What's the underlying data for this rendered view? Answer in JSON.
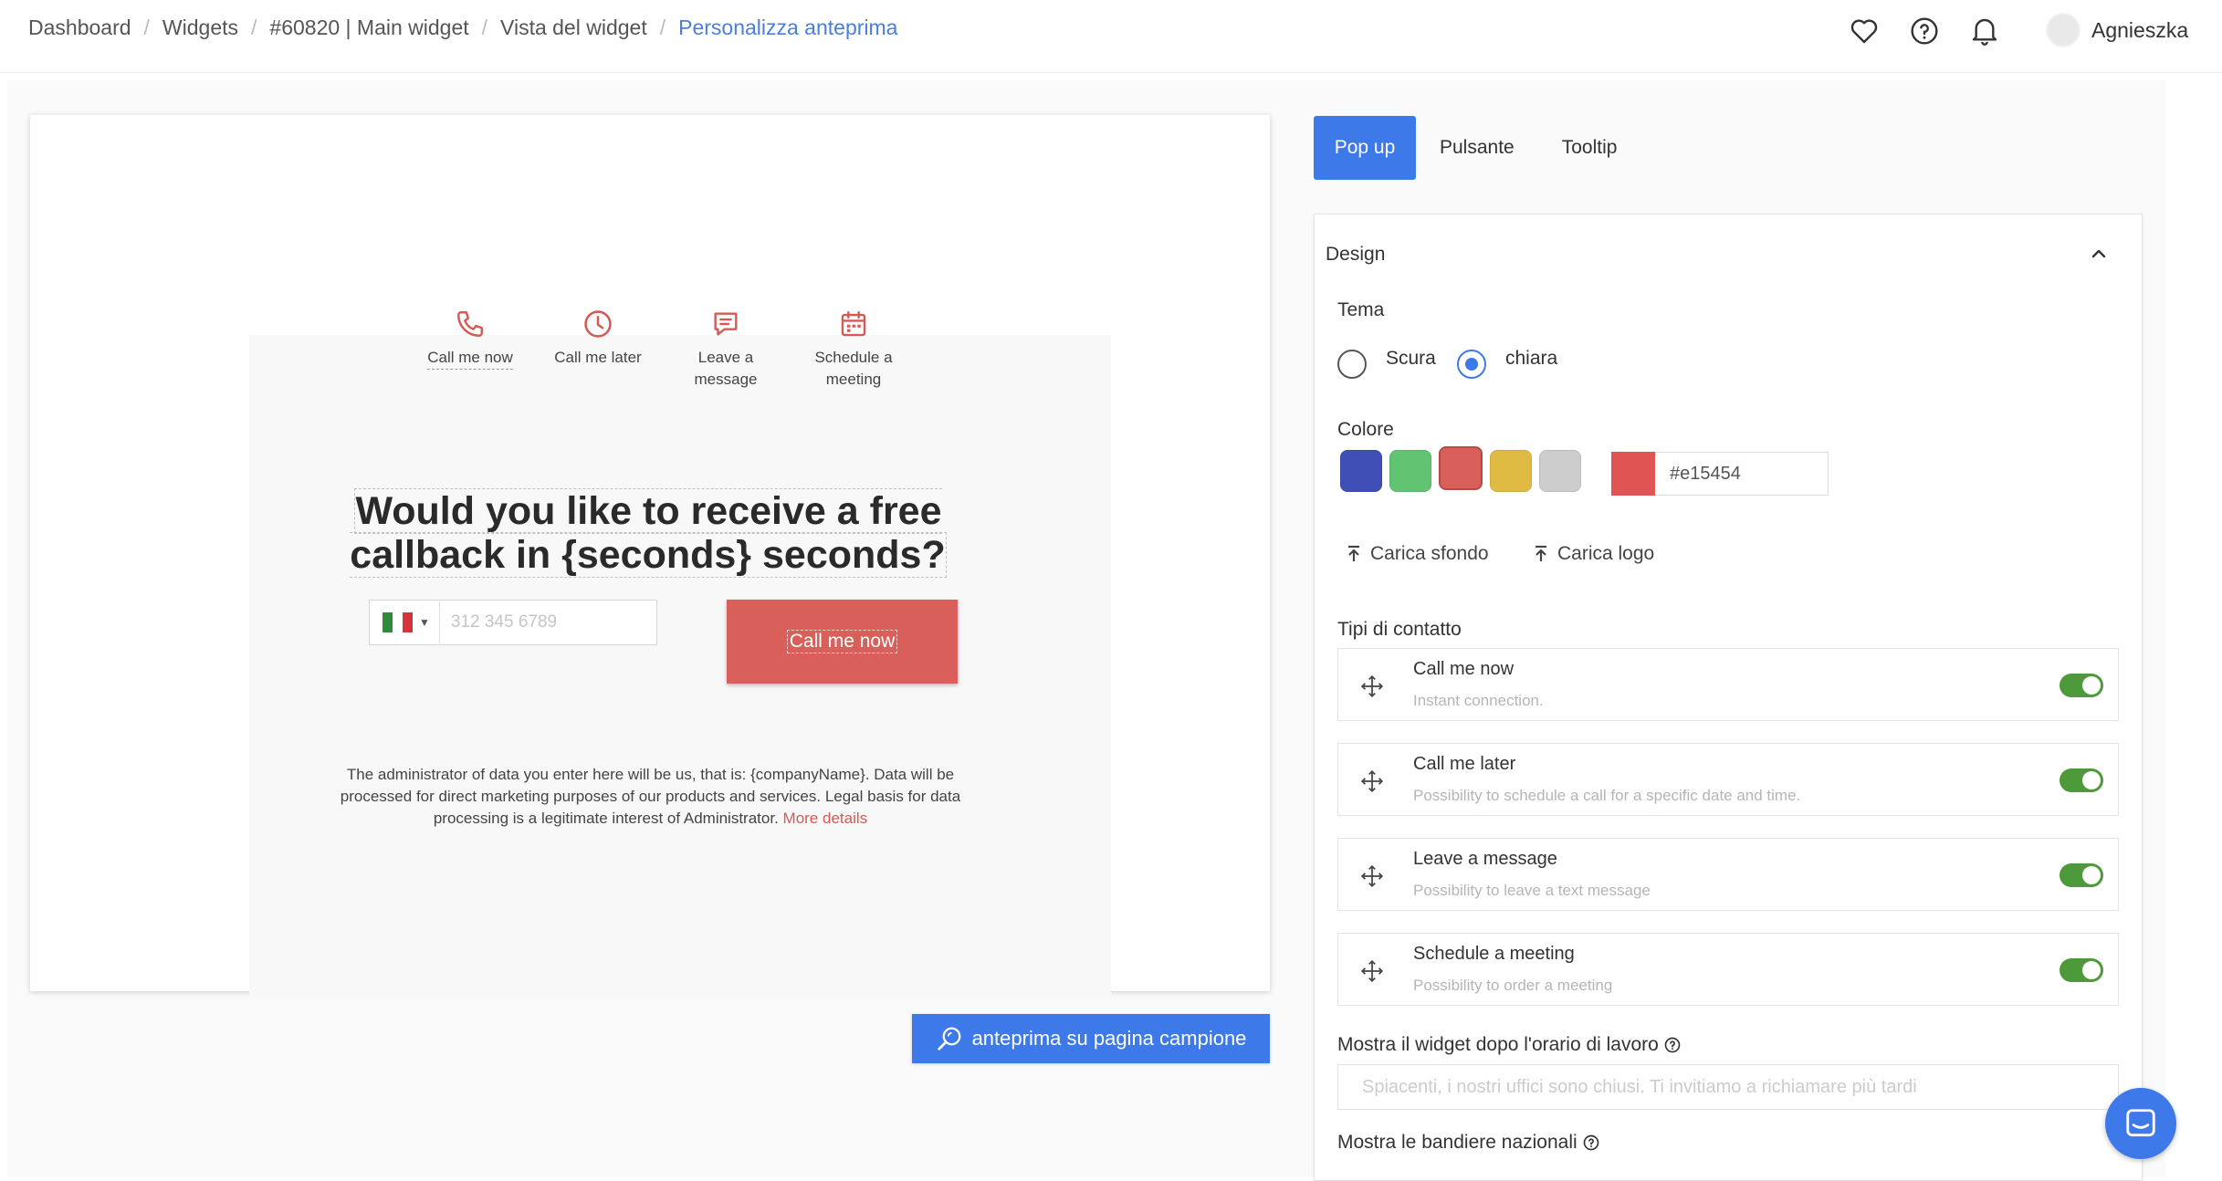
{
  "breadcrumb": [
    {
      "label": "Dashboard"
    },
    {
      "label": "Widgets"
    },
    {
      "label": "#60820 | Main widget"
    },
    {
      "label": "Vista del widget"
    },
    {
      "label": "Personalizza anteprima"
    }
  ],
  "header": {
    "icons": [
      "heart-icon",
      "help-icon",
      "bell-icon"
    ],
    "user_name": "Agnieszka"
  },
  "preview": {
    "contact_types": [
      {
        "icon": "phone-icon",
        "label": "Call me now"
      },
      {
        "icon": "clock-icon",
        "label": "Call me later"
      },
      {
        "icon": "message-icon",
        "label": "Leave a message"
      },
      {
        "icon": "calendar-icon",
        "label": "Schedule a meeting"
      }
    ],
    "headline": "Would you like to receive a free callback in {seconds} seconds?",
    "phone_placeholder": "312 345 6789",
    "call_button": "Call me now",
    "legal_text": "The administrator of data you enter here will be us, that is: {companyName}. Data will be processed for direct marketing purposes of our products and services. Legal basis for data processing is a legitimate interest of Administrator.",
    "more_details": "More details",
    "preview_button": "anteprima su pagina campione"
  },
  "tabs": [
    {
      "label": "Pop up",
      "active": true
    },
    {
      "label": "Pulsante",
      "active": false
    },
    {
      "label": "Tooltip",
      "active": false
    }
  ],
  "panel": {
    "title": "Design",
    "tema_label": "Tema",
    "tema_options": [
      {
        "label": "Scura",
        "checked": false
      },
      {
        "label": "chiara",
        "checked": true
      }
    ],
    "colore_label": "Colore",
    "swatches": [
      "#3f4fb5",
      "#62c373",
      "#d95f5a",
      "#e0bb44",
      "#cccccc"
    ],
    "selected_swatch": 2,
    "color_value": "#e15454",
    "upload_bg": "Carica sfondo",
    "upload_logo": "Carica logo",
    "contact_types_label": "Tipi di contatto",
    "contact_types": [
      {
        "title": "Call me now",
        "desc": "Instant connection.",
        "enabled": true
      },
      {
        "title": "Call me later",
        "desc": "Possibility to schedule a call for a specific date and time.",
        "enabled": true
      },
      {
        "title": "Leave a message",
        "desc": "Possibility to leave a text message",
        "enabled": true
      },
      {
        "title": "Schedule a meeting",
        "desc": "Possibility to order a meeting",
        "enabled": true
      }
    ],
    "after_hours_label": "Mostra il widget dopo l'orario di lavoro",
    "after_hours_placeholder": "Spiacenti, i nostri uffici sono chiusi. Ti invitiamo a richiamare più tardi",
    "flags_label": "Mostra le bandiere nazionali"
  },
  "colors": {
    "accent": "#3d79e8",
    "brand_red": "#e15454",
    "toggle_on": "#4c9a3a"
  }
}
